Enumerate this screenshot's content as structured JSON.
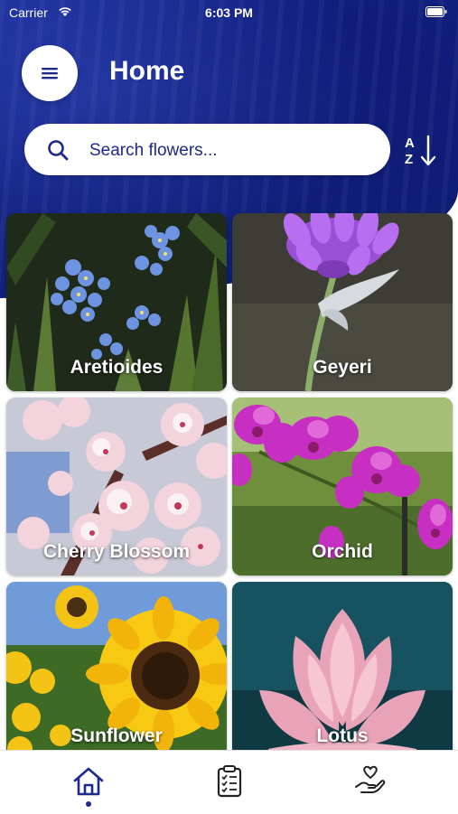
{
  "status_bar": {
    "carrier": "Carrier",
    "time": "6:03 PM",
    "wifi_icon": "wifi-icon",
    "battery_icon": "battery-icon"
  },
  "header": {
    "menu_icon": "hamburger-menu-icon",
    "title": "Home"
  },
  "search": {
    "icon": "search-icon",
    "placeholder": "Search flowers...",
    "value": ""
  },
  "sort": {
    "icon": "sort-alphabetical-icon"
  },
  "flowers": [
    {
      "name": "Aretioides"
    },
    {
      "name": "Geyeri"
    },
    {
      "name": "Cherry Blossom"
    },
    {
      "name": "Orchid"
    },
    {
      "name": "Sunflower"
    },
    {
      "name": "Lotus"
    }
  ],
  "bottom_nav": {
    "items": [
      {
        "icon": "home-icon",
        "active": true
      },
      {
        "icon": "clipboard-checklist-icon",
        "active": false
      },
      {
        "icon": "hand-heart-icon",
        "active": false
      }
    ]
  },
  "colors": {
    "accent": "#1d2a8a",
    "hero_blue": "#142483"
  }
}
